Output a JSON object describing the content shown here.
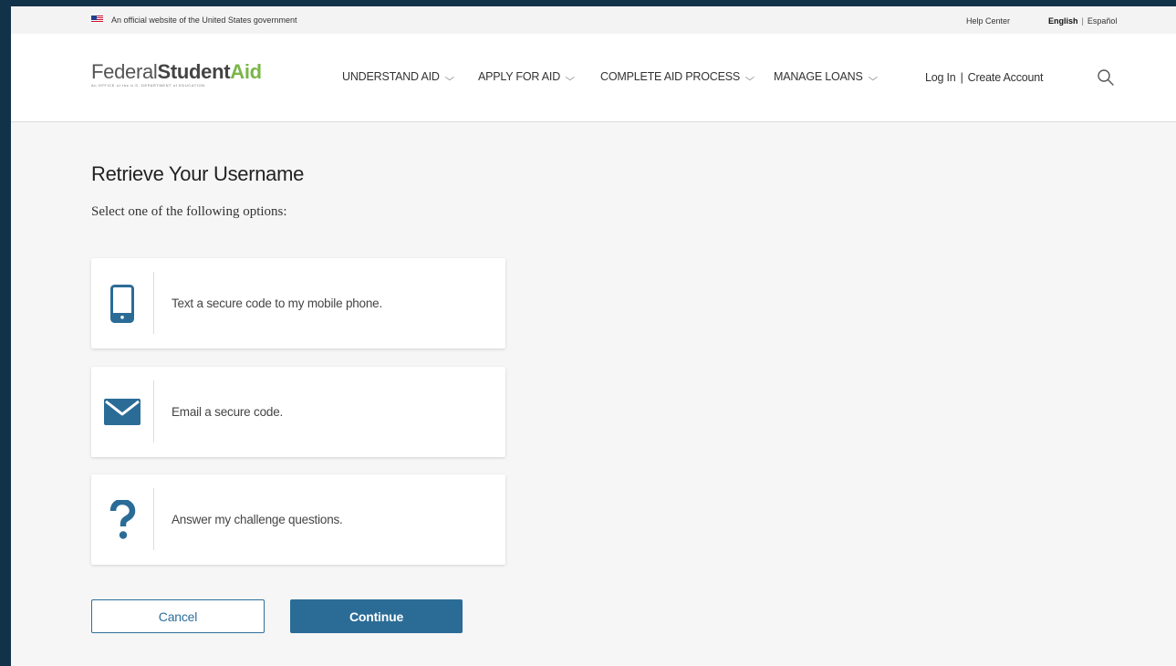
{
  "colors": {
    "outer_frame": "#12324a",
    "accent_blue": "#2b6c97",
    "brand_green": "#7ab648",
    "page_background": "#f6f6f6"
  },
  "gov_banner": {
    "flag_icon": "us-flag-icon",
    "text": "An official website of the United States government",
    "help_center": "Help Center",
    "lang_english": "English",
    "lang_separator": "|",
    "lang_spanish": "Español"
  },
  "header": {
    "logo": {
      "federal": "Federal",
      "student": "Student",
      "aid": "Aid",
      "subtitle": "An OFFICE of the U.S. DEPARTMENT of EDUCATION"
    },
    "nav": [
      {
        "label": "UNDERSTAND AID"
      },
      {
        "label": "APPLY FOR AID"
      },
      {
        "label": "COMPLETE AID PROCESS"
      },
      {
        "label": "MANAGE LOANS"
      }
    ],
    "login": "Log In",
    "account_separator": "|",
    "create_account": "Create Account",
    "search_icon": "search-icon"
  },
  "main": {
    "title": "Retrieve Your Username",
    "instructions": "Select one of the following options:",
    "options": [
      {
        "icon": "mobile-phone-icon",
        "label": "Text a secure code to my mobile phone."
      },
      {
        "icon": "envelope-icon",
        "label": "Email a secure code."
      },
      {
        "icon": "question-mark-icon",
        "label": "Answer my challenge questions."
      }
    ],
    "cancel_label": "Cancel",
    "continue_label": "Continue"
  }
}
